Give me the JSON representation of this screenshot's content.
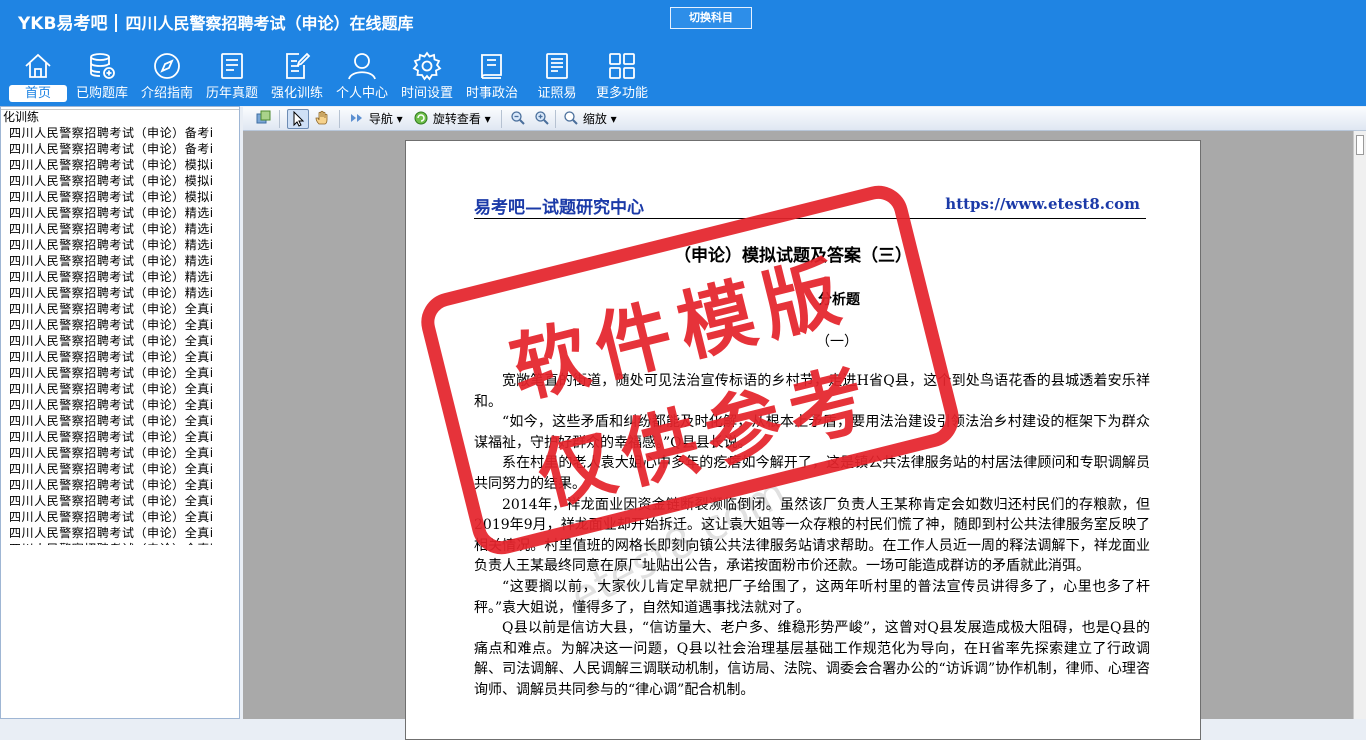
{
  "app": {
    "brand": "YKB易考吧",
    "title": "四川人民警察招聘考试（申论）在线题库",
    "switch_label": "切换科目"
  },
  "nav": [
    {
      "label": "首页",
      "icon": "home-icon",
      "active": true
    },
    {
      "label": "已购题库",
      "icon": "database-icon",
      "active": false
    },
    {
      "label": "介绍指南",
      "icon": "compass-icon",
      "active": false
    },
    {
      "label": "历年真题",
      "icon": "document-list-icon",
      "active": false
    },
    {
      "label": "强化训练",
      "icon": "edit-document-icon",
      "active": false
    },
    {
      "label": "个人中心",
      "icon": "user-icon",
      "active": false
    },
    {
      "label": "时间设置",
      "icon": "gear-icon",
      "active": false
    },
    {
      "label": "时事政治",
      "icon": "book-icon",
      "active": false
    },
    {
      "label": "证照易",
      "icon": "certificate-icon",
      "active": false
    },
    {
      "label": "更多功能",
      "icon": "grid-icon",
      "active": false
    }
  ],
  "left_panel": {
    "header": "化训练",
    "items": [
      "四川人民警察招聘考试（申论）备考i",
      "四川人民警察招聘考试（申论）备考i",
      "四川人民警察招聘考试（申论）模拟i",
      "四川人民警察招聘考试（申论）模拟i",
      "四川人民警察招聘考试（申论）模拟i",
      "四川人民警察招聘考试（申论）精选i",
      "四川人民警察招聘考试（申论）精选i",
      "四川人民警察招聘考试（申论）精选i",
      "四川人民警察招聘考试（申论）精选i",
      "四川人民警察招聘考试（申论）精选i",
      "四川人民警察招聘考试（申论）精选i",
      "四川人民警察招聘考试（申论）全真i",
      "四川人民警察招聘考试（申论）全真i",
      "四川人民警察招聘考试（申论）全真i",
      "四川人民警察招聘考试（申论）全真i",
      "四川人民警察招聘考试（申论）全真i",
      "四川人民警察招聘考试（申论）全真i",
      "四川人民警察招聘考试（申论）全真i",
      "四川人民警察招聘考试（申论）全真i",
      "四川人民警察招聘考试（申论）全真i",
      "四川人民警察招聘考试（申论）全真i",
      "四川人民警察招聘考试（申论）全真i",
      "四川人民警察招聘考试（申论）全真i",
      "四川人民警察招聘考试（申论）全真i",
      "四川人民警察招聘考试（申论）全真i",
      "四川人民警察招聘考试（申论）全真i",
      "四川人民警察招聘考试（申论）全真i"
    ]
  },
  "toolbar": {
    "nav_label": "导航",
    "rotate_label": "旋转查看",
    "zoom_label": "缩放"
  },
  "document": {
    "brand": "易考吧—试题研究中心",
    "url": "https://www.etest8.com",
    "title": "（申论）模拟试题及答案（三）",
    "subtitle": "分析题",
    "section_number": "（一）",
    "paragraphs": [
      "宽敞笔直的街道，随处可见法治宣传标语的乡村节，走进H省Q县，这个到处鸟语花香的县城透着安乐祥和。",
      "“如今，这些矛盾和纠纷都能及时化解，从根本上矛盾，要用法治建设引领法治乡村建设的框架下为群众谋福祉，守护好群众的幸福感。”Q县县长说。",
      "系在村里的老人袁大姐心中多年的疙瘩如今解开了，这是镇公共法律服务站的村居法律顾问和专职调解员共同努力的结果。",
      "2014年，祥龙面业因资金链断裂濒临倒闭。虽然该厂负责人王某称肯定会如数归还村民们的存粮款，但2019年9月，祥龙面业却开始拆迁。这让袁大姐等一众存粮的村民们慌了神，随即到村公共法律服务室反映了相关情况。村里值班的网格长即刻向镇公共法律服务站请求帮助。在工作人员近一周的释法调解下，祥龙面业负责人王某最终同意在原厂址贴出公告，承诺按面粉市价还款。一场可能造成群访的矛盾就此消弭。",
      "“这要搁以前，大家伙儿肯定早就把厂子给围了，这两年听村里的普法宣传员讲得多了，心里也多了杆秤。”袁大姐说，懂得多了，自然知道遇事找法就对了。",
      "Q县以前是信访大县，“信访量大、老户多、维稳形势严峻”，这曾对Q县发展造成极大阻碍，也是Q县的痛点和难点。为解决这一问题，Q县以社会治理基层基础工作规范化为导向，在H省率先探索建立了行政调解、司法调解、人民调解三调联动机制，信访局、法院、调委会合署办公的“访诉调”协作机制，律师、心理咨询师、调解员共同参与的“律心调”配合机制。"
    ]
  },
  "stamp": {
    "line1": "软件模版",
    "line2": "仅供参考",
    "color": "#e5242c"
  },
  "watermark": "etest8.com",
  "colors": {
    "header_bg": "#1f84e3",
    "doc_link": "#1b3aa8"
  }
}
